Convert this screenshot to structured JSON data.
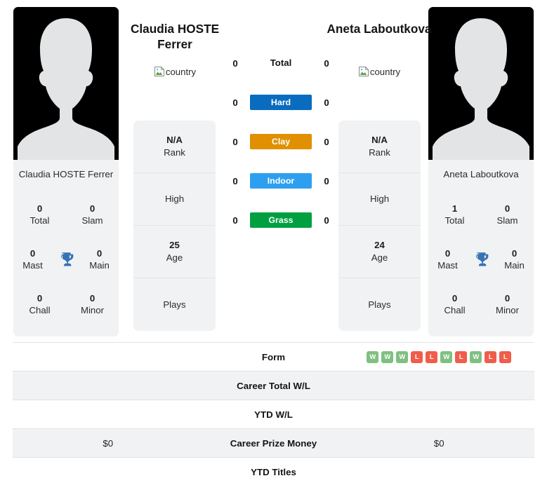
{
  "players": {
    "left": {
      "name_heading": "Claudia HOSTE Ferrer",
      "name_caption": "Claudia HOSTE Ferrer",
      "country_alt": "country",
      "titles": [
        {
          "value": "0",
          "label": "Total"
        },
        {
          "value": "0",
          "label": "Slam"
        },
        {
          "value": "0",
          "label": "Mast"
        },
        {
          "value": "0",
          "label": "Main"
        },
        {
          "value": "0",
          "label": "Chall"
        },
        {
          "value": "0",
          "label": "Minor"
        }
      ],
      "info": {
        "rank_value": "N/A",
        "rank_label": "Rank",
        "high_label": "High",
        "age_value": "25",
        "age_label": "Age",
        "plays_label": "Plays"
      },
      "prize_money": "$0"
    },
    "right": {
      "name_heading": "Aneta Laboutkova",
      "name_caption": "Aneta Laboutkova",
      "country_alt": "country",
      "titles": [
        {
          "value": "1",
          "label": "Total"
        },
        {
          "value": "0",
          "label": "Slam"
        },
        {
          "value": "0",
          "label": "Mast"
        },
        {
          "value": "0",
          "label": "Main"
        },
        {
          "value": "0",
          "label": "Chall"
        },
        {
          "value": "0",
          "label": "Minor"
        }
      ],
      "info": {
        "rank_value": "N/A",
        "rank_label": "Rank",
        "high_label": "High",
        "age_value": "24",
        "age_label": "Age",
        "plays_label": "Plays"
      },
      "prize_money": "$0"
    }
  },
  "surfaces": [
    {
      "label": "Total",
      "left": "0",
      "right": "0",
      "color": "none",
      "badge": false
    },
    {
      "label": "Hard",
      "left": "0",
      "right": "0",
      "color": "#0a6cbf",
      "badge": true
    },
    {
      "label": "Clay",
      "left": "0",
      "right": "0",
      "color": "#e09000",
      "badge": true
    },
    {
      "label": "Indoor",
      "left": "0",
      "right": "0",
      "color": "#2e9ff0",
      "badge": true
    },
    {
      "label": "Grass",
      "left": "0",
      "right": "0",
      "color": "#00a040",
      "badge": true
    }
  ],
  "comparison_rows": [
    {
      "label": "Form",
      "left": "",
      "right": "",
      "type": "form",
      "striped": false
    },
    {
      "label": "Career Total W/L",
      "left": "",
      "right": "",
      "type": "text",
      "striped": true
    },
    {
      "label": "YTD W/L",
      "left": "",
      "right": "",
      "type": "text",
      "striped": false
    },
    {
      "label": "Career Prize Money",
      "left": "$0",
      "right": "$0",
      "type": "text",
      "striped": true
    },
    {
      "label": "YTD Titles",
      "left": "",
      "right": "",
      "type": "text",
      "striped": false
    }
  ],
  "form_sequence": [
    "W",
    "W",
    "W",
    "L",
    "L",
    "W",
    "L",
    "W",
    "L",
    "L"
  ],
  "colors": {
    "win": "#7fc081",
    "loss": "#f05d4a",
    "trophy": "#3773b5",
    "card_bg": "#f1f2f3",
    "avatar_bg": "#000000",
    "silhouette": "#e3e4e5",
    "divider": "#e2e3e4"
  },
  "icons": {
    "trophy": "trophy-icon",
    "broken_image": "broken-image-icon",
    "avatar": "avatar-silhouette-icon"
  }
}
